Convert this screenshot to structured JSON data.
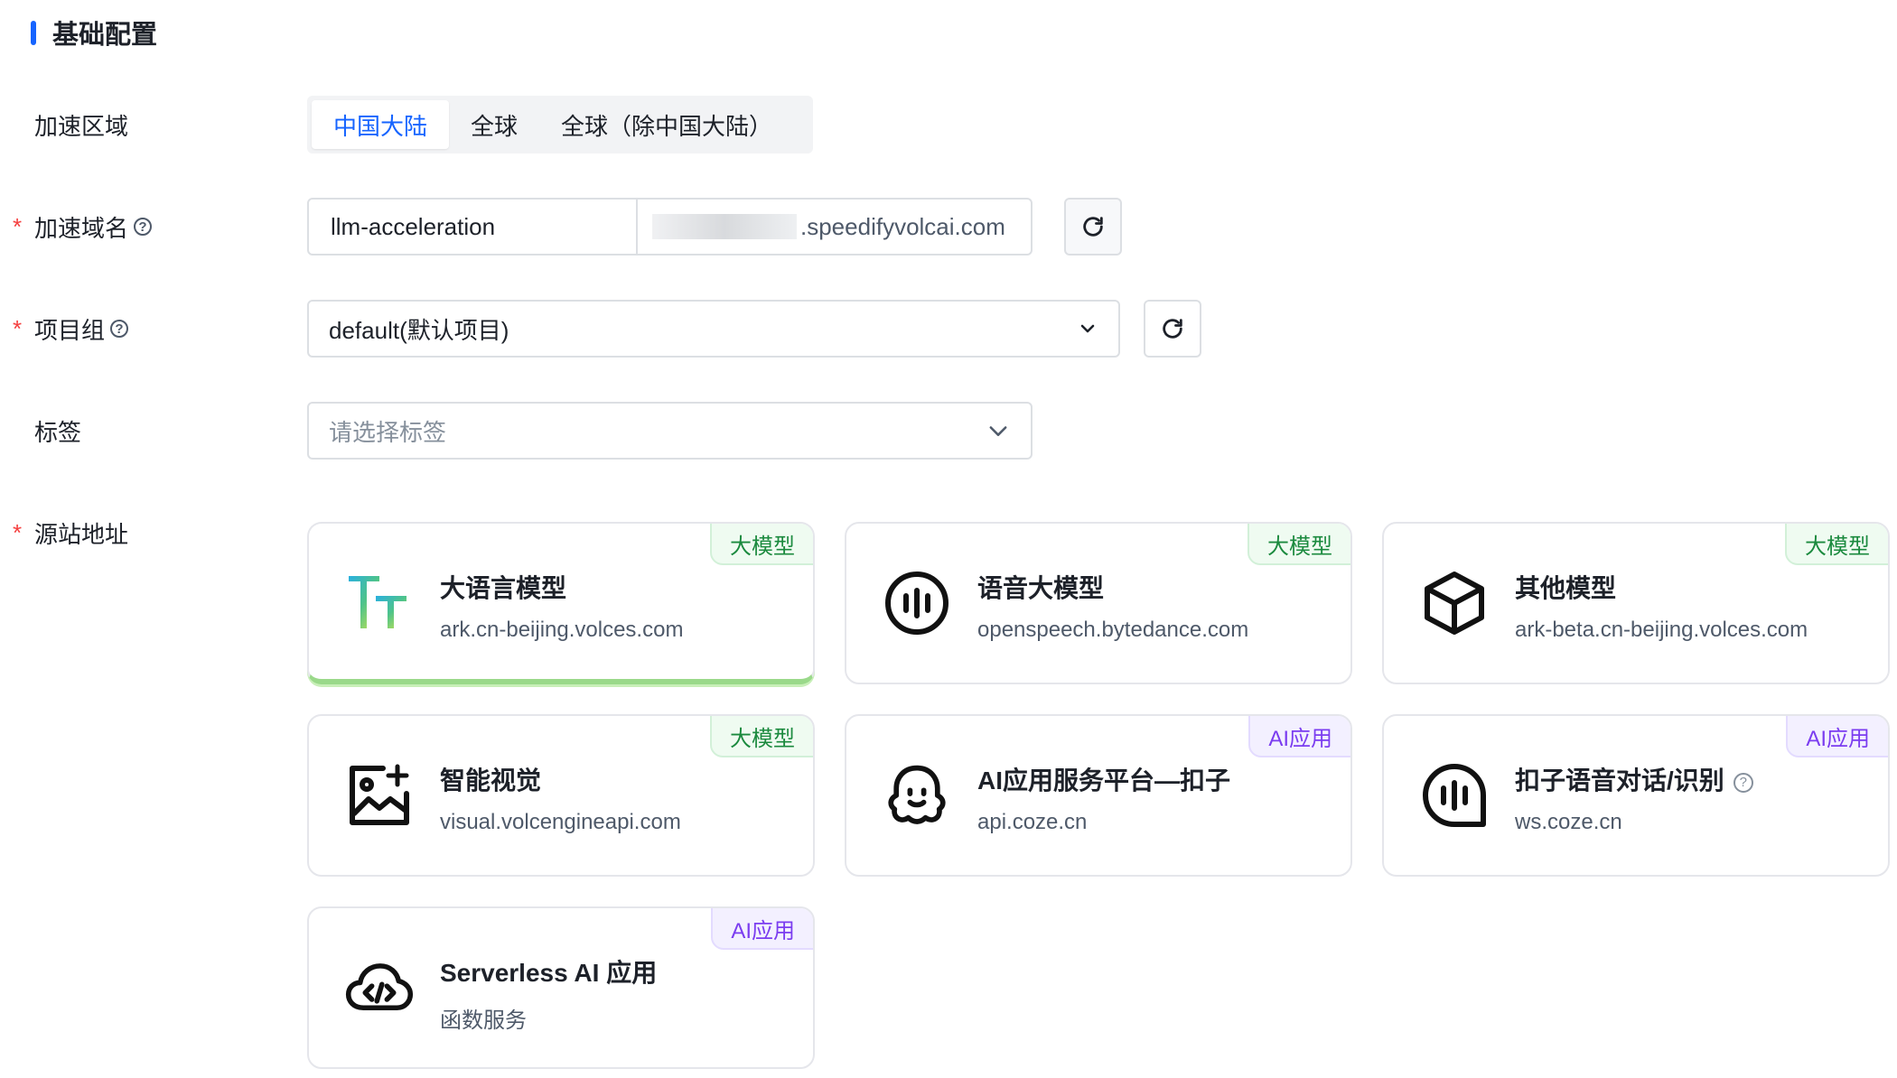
{
  "section": {
    "title": "基础配置"
  },
  "fields": {
    "region": {
      "label": "加速区域",
      "options": [
        "中国大陆",
        "全球",
        "全球（除中国大陆）"
      ],
      "selected": "中国大陆"
    },
    "domain": {
      "label": "加速域名",
      "required_mark": "*",
      "help": "?",
      "prefix_value": "llm-acceleration",
      "suffix": ".speedifyvolcai.com"
    },
    "project": {
      "label": "项目组",
      "required_mark": "*",
      "help": "?",
      "value": "default(默认项目)"
    },
    "tags": {
      "label": "标签",
      "placeholder": "请选择标签"
    },
    "origin": {
      "label": "源站地址",
      "required_mark": "*"
    }
  },
  "cards": [
    {
      "title": "大语言模型",
      "sub": "ark.cn-beijing.volces.com",
      "tag": "大模型",
      "tag_type": "model",
      "icon": "text-tt-icon",
      "selected": true
    },
    {
      "title": "语音大模型",
      "sub": "openspeech.bytedance.com",
      "tag": "大模型",
      "tag_type": "model",
      "icon": "voice-wave-icon",
      "selected": false
    },
    {
      "title": "其他模型",
      "sub": "ark-beta.cn-beijing.volces.com",
      "tag": "大模型",
      "tag_type": "model",
      "icon": "cube-icon",
      "selected": false
    },
    {
      "title": "智能视觉",
      "sub": "visual.volcengineapi.com",
      "tag": "大模型",
      "tag_type": "model",
      "icon": "image-sparkle-icon",
      "selected": false
    },
    {
      "title": "AI应用服务平台—扣子",
      "sub": "api.coze.cn",
      "tag": "AI应用",
      "tag_type": "app",
      "icon": "coze-face-icon",
      "selected": false
    },
    {
      "title": "扣子语音对话/识别",
      "sub": "ws.coze.cn",
      "tag": "AI应用",
      "tag_type": "app",
      "icon": "voice-bubble-icon",
      "selected": false,
      "help": "?"
    },
    {
      "title": "Serverless AI 应用",
      "sub": "函数服务",
      "tag": "AI应用",
      "tag_type": "app",
      "icon": "cloud-code-icon",
      "selected": false
    }
  ],
  "colors": {
    "primary": "#1664ff",
    "required": "#f53f3f",
    "model_tag": "#1b8a3e",
    "app_tag": "#7b3df0"
  }
}
